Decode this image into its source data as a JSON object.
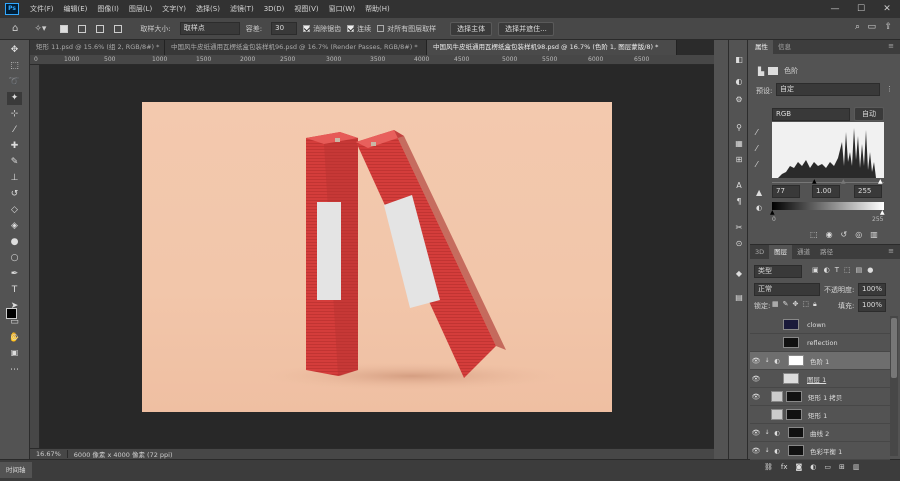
{
  "app": {
    "logo": "Ps"
  },
  "menu": [
    "文件(F)",
    "编辑(E)",
    "图像(I)",
    "图层(L)",
    "文字(Y)",
    "选择(S)",
    "滤镜(T)",
    "3D(D)",
    "视图(V)",
    "窗口(W)",
    "帮助(H)"
  ],
  "window_controls": [
    "—",
    "☐",
    "✕"
  ],
  "options": {
    "sample_size_label": "取样大小:",
    "sample_size_value": "取样点",
    "tolerance_label": "容差:",
    "tolerance_value": "30",
    "antialias_label": "消除锯齿",
    "contiguous_label": "连续",
    "sample_all_label": "对所有图层取样",
    "select_subject": "选择主体",
    "select_mask": "选择并遮住..."
  },
  "tabs": [
    "矩形 11.psd @ 15.6% (组 2, RGB/8#) *",
    "中国风牛皮纸通用瓦楞纸盒包装样机96.psd @ 16.7% (Render Passes, RGB/8#) *",
    "中国风牛皮纸通用瓦楞纸盒包装样机98.psd @ 16.7% (色阶 1, 图层蒙版/8) *"
  ],
  "ruler_top": [
    "0",
    "1000",
    "500",
    "1000",
    "1500",
    "2000",
    "2500",
    "3000",
    "3500",
    "4000",
    "4500",
    "5000",
    "5500",
    "6000",
    "6500"
  ],
  "status": {
    "zoom": "16.67%",
    "doc_size": "6000 像素 x 4000 像素 (72 ppi)"
  },
  "timeline_label": "时间轴",
  "properties": {
    "tabs": [
      "属性",
      "信息"
    ],
    "title": "色阶",
    "preset_label": "预设:",
    "preset_value": "自定",
    "channel": "RGB",
    "auto": "自动",
    "input_black": "77",
    "input_mid": "1.00",
    "input_white": "255",
    "output_black": "0",
    "output_white": "255"
  },
  "layers_panel": {
    "tabs": [
      "3D",
      "图层",
      "通道",
      "路径"
    ],
    "filter": "类型",
    "blend": "正常",
    "opacity_label": "不透明度:",
    "opacity": "100%",
    "lock_label": "锁定:",
    "fill_label": "填充:",
    "fill": "100%",
    "layers": [
      {
        "name": "clown",
        "visible": false
      },
      {
        "name": "reflection",
        "visible": false
      },
      {
        "name": "色阶 1",
        "visible": true
      },
      {
        "name": "图层 1",
        "visible": true
      },
      {
        "name": "矩形 1 拷贝",
        "visible": true
      },
      {
        "name": "矩形 1",
        "visible": false
      },
      {
        "name": "曲线 2",
        "visible": true
      },
      {
        "name": "色彩平衡 1",
        "visible": true
      }
    ]
  },
  "colors": {
    "accent": "#31a8ff",
    "box_red": "#d63c3a",
    "background_peach": "#f3c9ae"
  }
}
